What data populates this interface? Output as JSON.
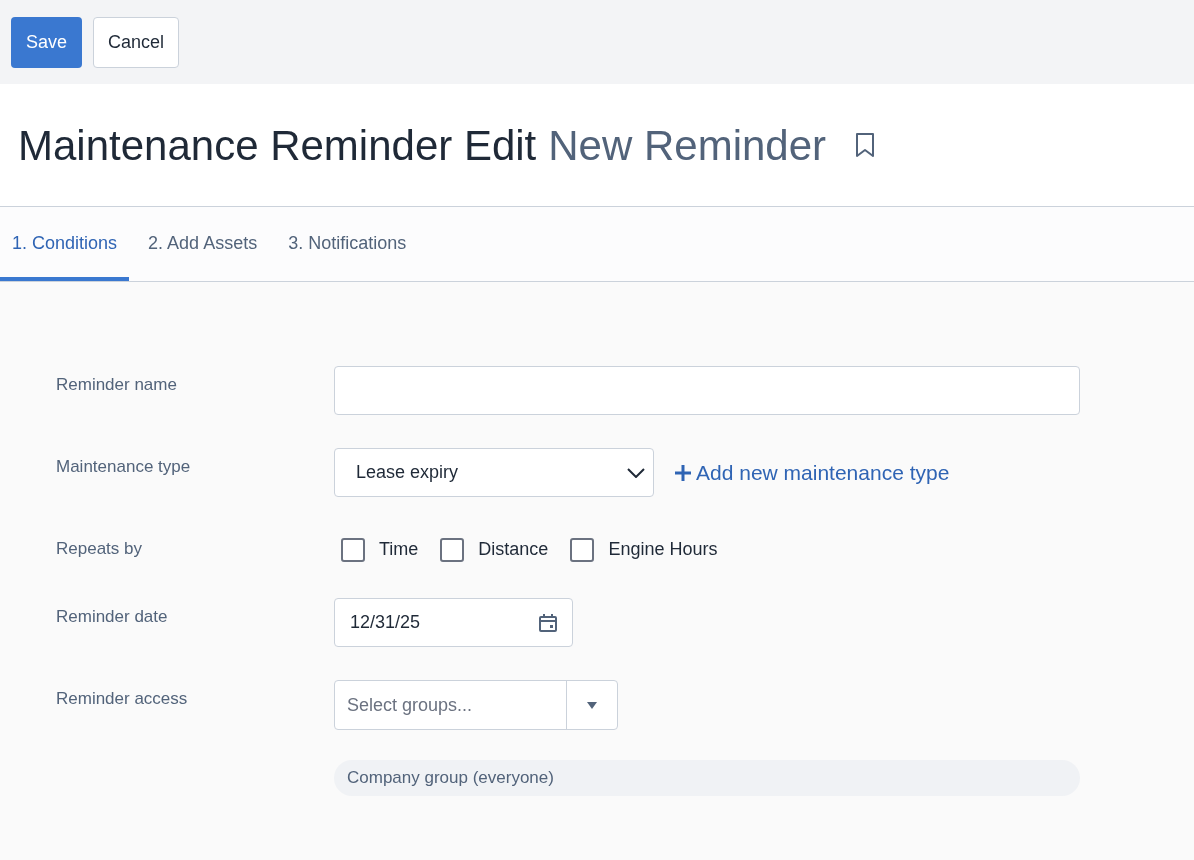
{
  "toolbar": {
    "buttons": [
      {
        "label": "Save",
        "kind": "primary"
      },
      {
        "label": "Cancel",
        "kind": "secondary"
      }
    ]
  },
  "header": {
    "title": "Maintenance Reminder Edit",
    "subtitle": "New Reminder",
    "bookmarked": false
  },
  "tabs": [
    {
      "label": "1. Conditions",
      "selected": true
    },
    {
      "label": "2. Add Assets",
      "selected": false
    },
    {
      "label": "3. Notifications",
      "selected": false
    }
  ],
  "form": [
    {
      "kind": "text",
      "label": "Reminder name"
    },
    {
      "kind": "select",
      "label": "Maintenance type",
      "value": "Lease expiry",
      "link": "Add new maintenance type"
    },
    {
      "kind": "checkboxes",
      "label": "Repeats by",
      "options": [
        {
          "label": "Time",
          "checked": false
        },
        {
          "label": "Distance",
          "checked": false
        },
        {
          "label": "Engine Hours",
          "checked": false
        }
      ]
    },
    {
      "kind": "date",
      "label": "Reminder date",
      "value": "12/31/25"
    },
    {
      "kind": "groups",
      "label": "Reminder access",
      "placeholder": "Select groups...",
      "chips": [
        "Company group (everyone)"
      ]
    }
  ]
}
